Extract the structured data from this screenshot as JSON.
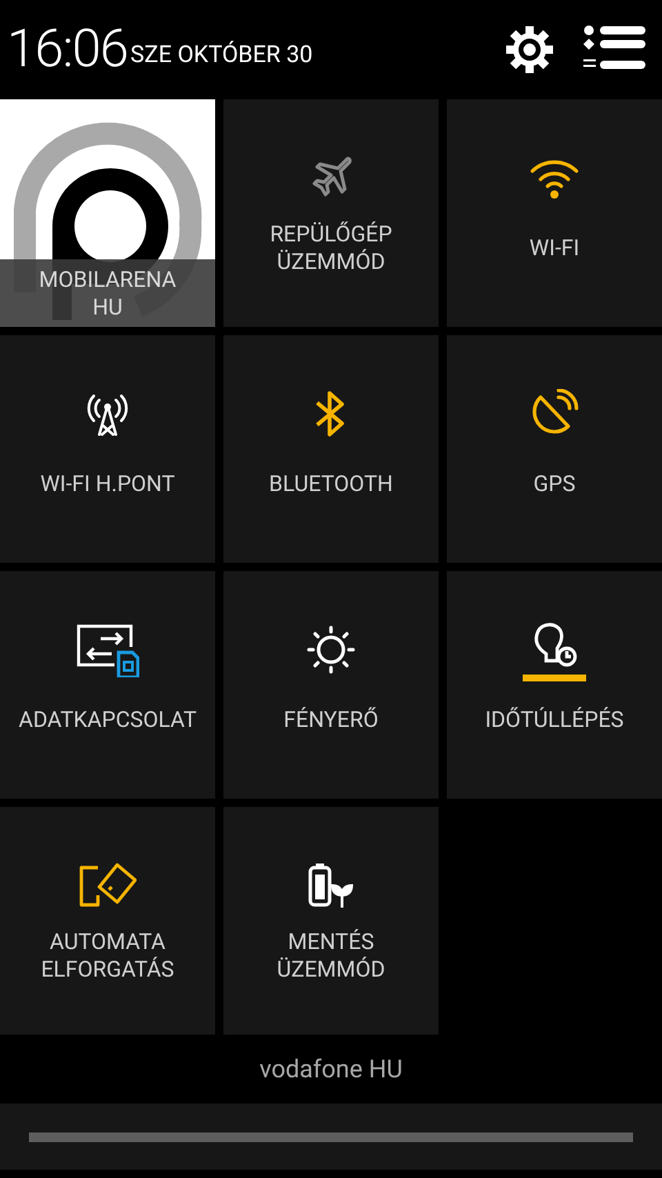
{
  "status_header": {
    "time": "16:06",
    "date": "SZE OKTÓBER 30"
  },
  "tiles": [
    {
      "kind": "shortcut",
      "label": "MOBILARENA HU"
    },
    {
      "kind": "airplane",
      "label": "REPÜLŐGÉP ÜZEMMÓD",
      "on": false
    },
    {
      "kind": "wifi",
      "label": "WI-FI",
      "on": true
    },
    {
      "kind": "hotspot",
      "label": "WI-FI H.PONT",
      "on": false
    },
    {
      "kind": "bluetooth",
      "label": "BLUETOOTH",
      "on": true
    },
    {
      "kind": "gps",
      "label": "GPS",
      "on": true
    },
    {
      "kind": "data",
      "label": "ADATKAPCSOLAT",
      "on": false
    },
    {
      "kind": "brightness",
      "label": "FÉNYERŐ",
      "on": false
    },
    {
      "kind": "timeout",
      "label": "IDŐTÚLLÉPÉS",
      "on": false,
      "level": 1
    },
    {
      "kind": "rotation",
      "label": "AUTOMATA ELFORGATÁS",
      "on": true
    },
    {
      "kind": "powersave",
      "label": "MENTÉS ÜZEMMÓD",
      "on": false
    }
  ],
  "carrier": "vodafone HU"
}
